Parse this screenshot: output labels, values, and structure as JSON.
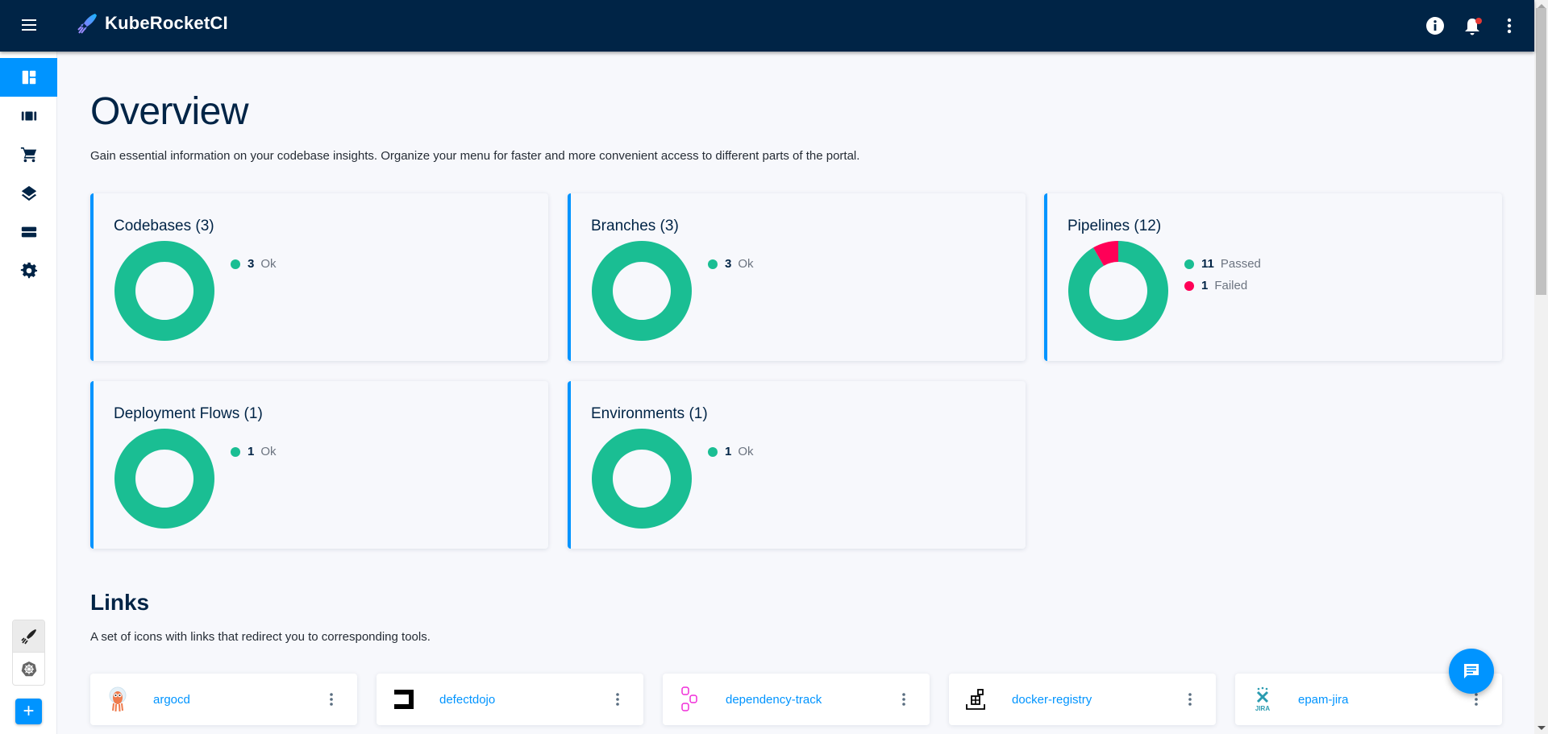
{
  "app": {
    "title": "KubeRocketCI",
    "notifications_unread": true
  },
  "header": {
    "menu_icon": "hamburger-menu-icon",
    "actions": [
      {
        "name": "info",
        "icon": "info-icon"
      },
      {
        "name": "notifications",
        "icon": "bell-icon"
      },
      {
        "name": "more",
        "icon": "more-vertical-icon"
      }
    ]
  },
  "sidebar": {
    "items": [
      {
        "name": "overview",
        "icon": "dashboard-icon",
        "active": true
      },
      {
        "name": "components",
        "icon": "view-array-icon",
        "active": false
      },
      {
        "name": "marketplace",
        "icon": "cart-icon",
        "active": false
      },
      {
        "name": "deployment-flows",
        "icon": "layers-icon",
        "active": false
      },
      {
        "name": "environments",
        "icon": "storage-icon",
        "active": false
      },
      {
        "name": "configuration",
        "icon": "gear-icon",
        "active": false
      }
    ],
    "bottom": [
      {
        "name": "kuberocketci-mode",
        "icon": "rocket-icon",
        "selected": true
      },
      {
        "name": "kubernetes-mode",
        "icon": "kubernetes-icon",
        "selected": false
      }
    ],
    "add_label": "+"
  },
  "page": {
    "title": "Overview",
    "subtitle": "Gain essential information on your codebase insights. Organize your menu for faster and more convenient access to different parts of the portal."
  },
  "colors": {
    "ok": "#1abe93",
    "failed": "#ff0057",
    "accent": "#0094ff",
    "navy": "#002446"
  },
  "cards": [
    {
      "title": "Codebases (3)",
      "legend": [
        {
          "value": "3",
          "label": "Ok",
          "status": "ok"
        }
      ]
    },
    {
      "title": "Branches (3)",
      "legend": [
        {
          "value": "3",
          "label": "Ok",
          "status": "ok"
        }
      ]
    },
    {
      "title": "Pipelines (12)",
      "legend": [
        {
          "value": "11",
          "label": "Passed",
          "status": "ok"
        },
        {
          "value": "1",
          "label": "Failed",
          "status": "failed"
        }
      ]
    },
    {
      "title": "Deployment Flows (1)",
      "legend": [
        {
          "value": "1",
          "label": "Ok",
          "status": "ok"
        }
      ]
    },
    {
      "title": "Environments (1)",
      "legend": [
        {
          "value": "1",
          "label": "Ok",
          "status": "ok"
        }
      ]
    }
  ],
  "chart_data": [
    {
      "type": "pie",
      "title": "Codebases (3)",
      "categories": [
        "Ok"
      ],
      "values": [
        3
      ],
      "colors": [
        "#1abe93"
      ],
      "donut": true
    },
    {
      "type": "pie",
      "title": "Branches (3)",
      "categories": [
        "Ok"
      ],
      "values": [
        3
      ],
      "colors": [
        "#1abe93"
      ],
      "donut": true
    },
    {
      "type": "pie",
      "title": "Pipelines (12)",
      "categories": [
        "Passed",
        "Failed"
      ],
      "values": [
        11,
        1
      ],
      "colors": [
        "#1abe93",
        "#ff0057"
      ],
      "donut": true
    },
    {
      "type": "pie",
      "title": "Deployment Flows (1)",
      "categories": [
        "Ok"
      ],
      "values": [
        1
      ],
      "colors": [
        "#1abe93"
      ],
      "donut": true
    },
    {
      "type": "pie",
      "title": "Environments (1)",
      "categories": [
        "Ok"
      ],
      "values": [
        1
      ],
      "colors": [
        "#1abe93"
      ],
      "donut": true
    }
  ],
  "links": {
    "title": "Links",
    "subtitle": "A set of icons with links that redirect you to corresponding tools.",
    "items": [
      {
        "name": "argocd",
        "icon": "argocd-icon"
      },
      {
        "name": "defectdojo",
        "icon": "defectdojo-icon"
      },
      {
        "name": "dependency-track",
        "icon": "dependency-track-icon"
      },
      {
        "name": "docker-registry",
        "icon": "docker-registry-icon"
      },
      {
        "name": "epam-jira",
        "icon": "jira-icon"
      }
    ]
  },
  "fab": {
    "icon": "chat-icon"
  }
}
